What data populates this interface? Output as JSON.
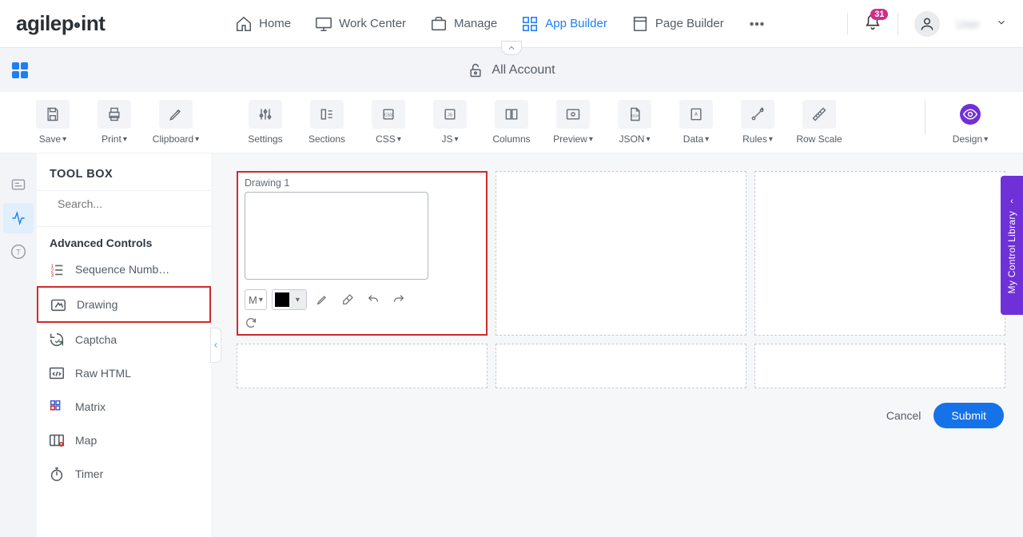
{
  "logo": "agilepoint",
  "nav": {
    "home": "Home",
    "work_center": "Work Center",
    "manage": "Manage",
    "app_builder": "App Builder",
    "page_builder": "Page Builder"
  },
  "notif_count": "31",
  "username": "User",
  "context": {
    "title": "All Account"
  },
  "toolbar": {
    "save": "Save",
    "print": "Print",
    "clipboard": "Clipboard",
    "settings": "Settings",
    "sections": "Sections",
    "css": "CSS",
    "js": "JS",
    "columns": "Columns",
    "preview": "Preview",
    "json": "JSON",
    "data": "Data",
    "rules": "Rules",
    "row_scale": "Row Scale",
    "design": "Design"
  },
  "toolbox": {
    "title": "TOOL BOX",
    "search_placeholder": "Search...",
    "section": "Advanced Controls",
    "items": {
      "sequence": "Sequence Numb…",
      "drawing": "Drawing",
      "captcha": "Captcha",
      "raw_html": "Raw HTML",
      "matrix": "Matrix",
      "map": "Map",
      "timer": "Timer"
    }
  },
  "drawing": {
    "label": "Drawing 1",
    "size": "M"
  },
  "footer": {
    "cancel": "Cancel",
    "submit": "Submit"
  },
  "right_drawer": "My Control Library"
}
